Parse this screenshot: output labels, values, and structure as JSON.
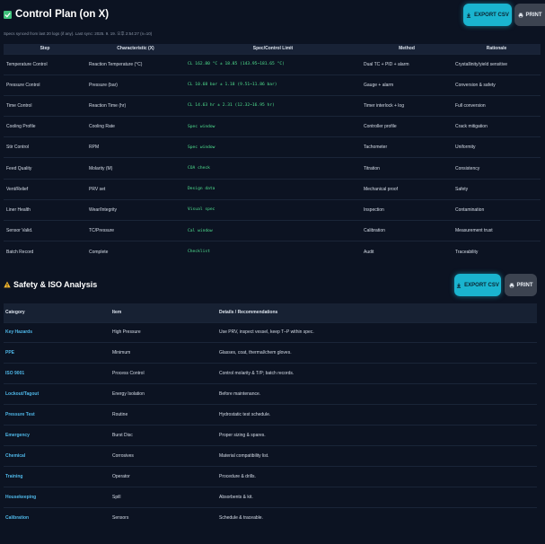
{
  "control_plan": {
    "title": "Control Plan (on X)",
    "subtitle": "Specs synced from last 20 logs (if any). Last sync: 2025. 9. 19. 오후 2:54:27 (n=10)",
    "export_label": "EXPORT CSV",
    "print_label": "PRINT",
    "headers": [
      "Step",
      "Characteristic (X)",
      "Spec/Control Limit",
      "Method",
      "Rationale"
    ],
    "rows": [
      [
        "Temperature Control",
        "Reaction Temperature (°C)",
        "CL 162.80 °C ± 18.85 (143.95~181.65 °C)",
        "Dual TC + PID + alarm",
        "Crystallinity/yield sensitive"
      ],
      [
        "Pressure Control",
        "Pressure (bar)",
        "CL 10.68 bar ± 1.18 (9.51~11.86 bar)",
        "Gauge + alarm",
        "Conversion & safety"
      ],
      [
        "Time Control",
        "Reaction Time (hr)",
        "CL 14.63 hr ± 2.31 (12.32~16.95 hr)",
        "Timer interlock + log",
        "Full conversion"
      ],
      [
        "Cooling Profile",
        "Cooling Rate",
        "Spec window",
        "Controller profile",
        "Crack mitigation"
      ],
      [
        "Stir Control",
        "RPM",
        "Spec window",
        "Tachometer",
        "Uniformity"
      ],
      [
        "Feed Quality",
        "Molarity (M)",
        "COA check",
        "Titration",
        "Consistency"
      ],
      [
        "Vent/Relief",
        "PRV set",
        "Design data",
        "Mechanical proof",
        "Safety"
      ],
      [
        "Liner Health",
        "Wear/Integrity",
        "Visual spec",
        "Inspection",
        "Contamination"
      ],
      [
        "Sensor Valid.",
        "TC/Pressure",
        "Cal window",
        "Calibration",
        "Measurement trust"
      ],
      [
        "Batch Record",
        "Complete",
        "Checklist",
        "Audit",
        "Traceability"
      ]
    ]
  },
  "safety": {
    "title": "Safety & ISO Analysis",
    "export_label": "EXPORT CSV",
    "print_label": "PRINT",
    "headers": [
      "Category",
      "Item",
      "Details / Recommendations"
    ],
    "rows": [
      [
        "Key Hazards",
        "High Pressure",
        "Use PRV, inspect vessel, keep T–P within spec."
      ],
      [
        "PPE",
        "Minimum",
        "Glasses, coat, thermal/chem gloves."
      ],
      [
        "ISO 9001",
        "Process Control",
        "Control molarity & T/P; batch records."
      ],
      [
        "Lockout/Tagout",
        "Energy Isolation",
        "Before maintenance."
      ],
      [
        "Pressure Test",
        "Routine",
        "Hydrostatic test schedule."
      ],
      [
        "Emergency",
        "Burst Disc",
        "Proper sizing & spares."
      ],
      [
        "Chemical",
        "Corrosives",
        "Material compatibility list."
      ],
      [
        "Training",
        "Operator",
        "Procedure & drills."
      ],
      [
        "Housekeeping",
        "Spill",
        "Absorbents & kit."
      ],
      [
        "Calibration",
        "Sensors",
        "Schedule & traceable."
      ]
    ]
  },
  "colors": {
    "background": "#0c1322",
    "accent": "#1ab4cf",
    "category": "#4fb7e8",
    "spec": "#4fe08f"
  },
  "icons": [
    "download-icon",
    "printer-icon",
    "warning-icon"
  ]
}
